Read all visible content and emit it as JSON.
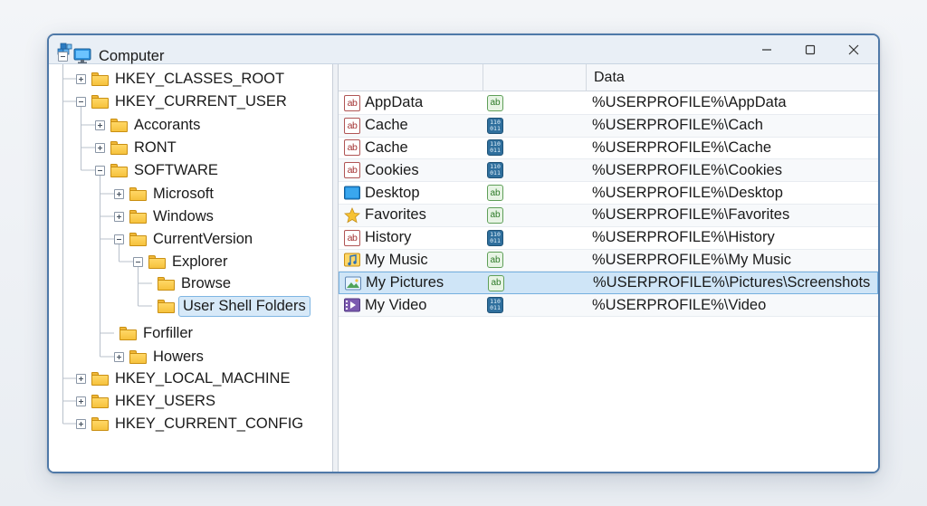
{
  "tree": {
    "nodes": [
      {
        "label": "Computer",
        "kind": "computer",
        "expander": "minus"
      },
      {
        "label": "HKEY_CLASSES_ROOT",
        "kind": "folder",
        "expander": "plus"
      },
      {
        "label": "HKEY_CURRENT_USER",
        "kind": "folder",
        "expander": "minus"
      },
      {
        "label": "Accorants",
        "kind": "folder",
        "expander": "plus"
      },
      {
        "label": "RONT",
        "kind": "folder",
        "expander": "plus"
      },
      {
        "label": "SOFTWARE",
        "kind": "folder",
        "expander": "minus"
      },
      {
        "label": "Microsoft",
        "kind": "folder",
        "expander": "plus"
      },
      {
        "label": "Windows",
        "kind": "folder",
        "expander": "plus"
      },
      {
        "label": "CurrentVersion",
        "kind": "folder",
        "expander": "minus"
      },
      {
        "label": "Explorer",
        "kind": "folder",
        "expander": "minus"
      },
      {
        "label": "Browse",
        "kind": "folder",
        "expander": "none"
      },
      {
        "label": "User Shell Folders",
        "kind": "folder",
        "expander": "none",
        "selected": true
      },
      {
        "label": "Forfiller",
        "kind": "folder",
        "expander": "none"
      },
      {
        "label": "Howers",
        "kind": "folder",
        "expander": "plus"
      },
      {
        "label": "HKEY_LOCAL_MACHINE",
        "kind": "folder",
        "expander": "plus"
      },
      {
        "label": "HKEY_USERS",
        "kind": "folder",
        "expander": "plus"
      },
      {
        "label": "HKEY_CURRENT_CONFIG",
        "kind": "folder",
        "expander": "plus"
      }
    ]
  },
  "columns": {
    "name": "",
    "type": "",
    "data": "Data"
  },
  "rows": [
    {
      "name": "AppData",
      "icon": "string-value-icon",
      "type": "sz",
      "data": "%USERPROFILE%\\AppData"
    },
    {
      "name": "Cache",
      "icon": "string-value-icon",
      "type": "bin",
      "data": "%USERPROFILE%\\Cach"
    },
    {
      "name": "Cache",
      "icon": "string-value-icon",
      "type": "bin",
      "data": "%USERPROFILE%\\Cache"
    },
    {
      "name": "Cookies",
      "icon": "string-value-icon",
      "type": "bin",
      "data": "%USERPROFILE%\\Cookies"
    },
    {
      "name": "Desktop",
      "icon": "desktop-icon",
      "type": "sz",
      "data": "%USERPROFILE%\\Desktop"
    },
    {
      "name": "Favorites",
      "icon": "star-icon",
      "type": "sz",
      "data": "%USERPROFILE%\\Favorites"
    },
    {
      "name": "History",
      "icon": "string-value-icon",
      "type": "bin",
      "data": "%USERPROFILE%\\History"
    },
    {
      "name": "My Music",
      "icon": "music-icon",
      "type": "sz",
      "data": "%USERPROFILE%\\My Music"
    },
    {
      "name": "My Pictures",
      "icon": "pictures-icon",
      "type": "sz",
      "data": "%USERPROFILE%\\Pictures\\Screenshots",
      "selected": true
    },
    {
      "name": "My Video",
      "icon": "video-icon",
      "type": "bin",
      "data": "%USERPROFILE%\\Video"
    }
  ],
  "icon_text": {
    "string": "ab",
    "sz": "ab",
    "bin": "110\n011"
  },
  "colors": {
    "accent": "#4f79a8",
    "selection": "#cfe5f7",
    "folder": "#f6c23d"
  }
}
